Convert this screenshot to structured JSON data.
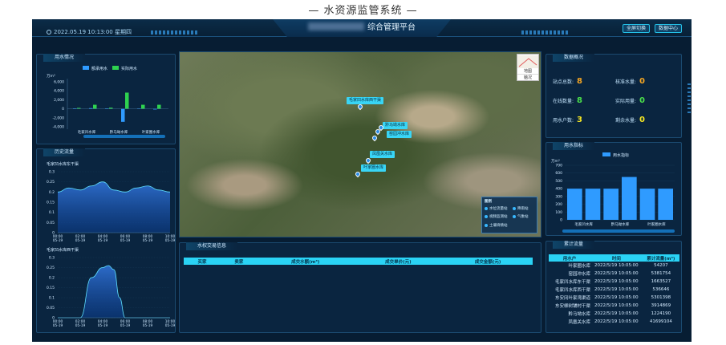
{
  "caption": "— 水资源监管系统 —",
  "header": {
    "datetime": "2022.05.19 10:13:00 星期四",
    "title": "综合管理平台",
    "btn_fullscreen": "全屏切换",
    "btn_data": "数据中心"
  },
  "water_usage": {
    "title": "用水情况",
    "legend_plan": "额承用水",
    "legend_actual": "实际用水",
    "unit": "万m³",
    "yticks": [
      "6,000",
      "4,000",
      "2,000",
      "0",
      "-2,000",
      "-4,000"
    ],
    "categories": [
      "毛家凹水库",
      "黔马坳水库",
      "叶家圈水库"
    ]
  },
  "history": {
    "title": "历史流量",
    "chart1_title": "毛家凹水库东干渠",
    "chart2_title": "毛家凹水库西干渠",
    "yticks1": [
      "0.3",
      "0.25",
      "0.2",
      "0.15",
      "0.1",
      "0.05",
      "0"
    ],
    "yticks2": [
      "0.3",
      "0.25",
      "0.2",
      "0.15",
      "0.1",
      "0.05",
      "0"
    ],
    "xticks": [
      "00:00\n05-19",
      "02:00\n05-19",
      "04:00\n05-19",
      "06:00\n05-19",
      "08:00\n05-19",
      "10:00\n05-19"
    ]
  },
  "map": {
    "markers": [
      "毛家凹水库西干渠",
      "黔马坳水库",
      "窑园冲水库",
      "凤凰关水库",
      "叶家圈水库"
    ],
    "map_btn": "地图",
    "sat_btn": "脑况",
    "legend_title": "图例",
    "legend": [
      "水位流量站",
      "降雨站",
      "视频监测站",
      "气象站",
      "土壤墒情站"
    ]
  },
  "trade": {
    "title": "水权交易信息",
    "cols": [
      "买家",
      "卖家",
      "成交水额(m³)",
      "成交单价(元)",
      "成交金额(元)"
    ]
  },
  "overview": {
    "title": "数据概况",
    "items": [
      {
        "label": "站点总数:",
        "value": "8",
        "color": "#f5a623"
      },
      {
        "label": "核准水量:",
        "value": "0",
        "color": "#f5a623"
      },
      {
        "label": "在线数量:",
        "value": "8",
        "color": "#4be04b"
      },
      {
        "label": "实际用量:",
        "value": "0",
        "color": "#4be04b"
      },
      {
        "label": "用水户数:",
        "value": "3",
        "color": "#f5e623"
      },
      {
        "label": "剩余水量:",
        "value": "0",
        "color": "#f5e623"
      }
    ]
  },
  "quota": {
    "title": "用水指标",
    "legend": "用水指标",
    "unit": "万m³",
    "yticks": [
      "700",
      "600",
      "500",
      "400",
      "300",
      "200",
      "100",
      "0"
    ],
    "categories": [
      "毛家凹水库",
      "黔马坳水库",
      "叶家圈水库"
    ]
  },
  "flow": {
    "title": "累计流量",
    "cols": [
      "用水户",
      "时间",
      "累计流量(m³)"
    ],
    "rows": [
      [
        "叶家圈水库",
        "2022/5/19 10:05:00",
        "54207"
      ],
      [
        "窑园冲水库",
        "2022/5/19 10:05:00",
        "5381754"
      ],
      [
        "毛家凹水库东干渠",
        "2022/5/19 10:05:00",
        "1663527"
      ],
      [
        "毛家凹水库西干渠",
        "2022/5/19 10:05:00",
        "536646"
      ],
      [
        "东安冈叶家湾渠道",
        "2022/5/19 10:05:00",
        "5301398"
      ],
      [
        "东安柳树铺村干渠",
        "2022/5/19 10:05:00",
        "3914869"
      ],
      [
        "黔马坳水库",
        "2022/5/19 10:05:00",
        "1224190"
      ],
      [
        "凤凰关水库",
        "2022/5/19 10:05:00",
        "41699104"
      ]
    ]
  },
  "chart_data": [
    {
      "type": "bar",
      "title": "用水情况",
      "categories": [
        "毛家凹水库",
        "",
        "黔马坳水库",
        "",
        "叶家圈水库",
        ""
      ],
      "series": [
        {
          "name": "额承用水",
          "values": [
            100,
            150,
            100,
            -2900,
            50,
            -150
          ]
        },
        {
          "name": "实际用水",
          "values": [
            200,
            900,
            250,
            3600,
            900,
            900
          ]
        }
      ],
      "ylim": [
        -4000,
        6000
      ],
      "colors": [
        "#2f9bff",
        "#2ed24f"
      ]
    },
    {
      "type": "area",
      "title": "毛家凹水库东干渠",
      "x": [
        "00:00",
        "01:00",
        "02:00",
        "03:00",
        "04:00",
        "05:00",
        "06:00",
        "07:00",
        "08:00",
        "09:00",
        "10:00"
      ],
      "values": [
        0.2,
        0.22,
        0.21,
        0.23,
        0.25,
        0.21,
        0.2,
        0.22,
        0.23,
        0.21,
        0.2
      ],
      "ylim": [
        0,
        0.3
      ]
    },
    {
      "type": "area",
      "title": "毛家凹水库西干渠",
      "x": [
        "00:00",
        "01:00",
        "02:00",
        "03:00",
        "04:00",
        "04:30",
        "05:00",
        "05:30",
        "06:00",
        "07:00",
        "08:00",
        "09:00",
        "10:00"
      ],
      "values": [
        0,
        0,
        0,
        0.2,
        0.25,
        0.26,
        0.24,
        0.1,
        0,
        0,
        0,
        0,
        0
      ],
      "ylim": [
        0,
        0.3
      ]
    },
    {
      "type": "bar",
      "title": "用水指标",
      "categories": [
        "毛家凹水库",
        "",
        "黔马坳水库",
        "",
        "叶家圈水库",
        ""
      ],
      "series": [
        {
          "name": "用水指标",
          "values": [
            400,
            400,
            400,
            550,
            400,
            400
          ]
        }
      ],
      "ylim": [
        0,
        700
      ],
      "colors": [
        "#2f9bff"
      ]
    }
  ]
}
